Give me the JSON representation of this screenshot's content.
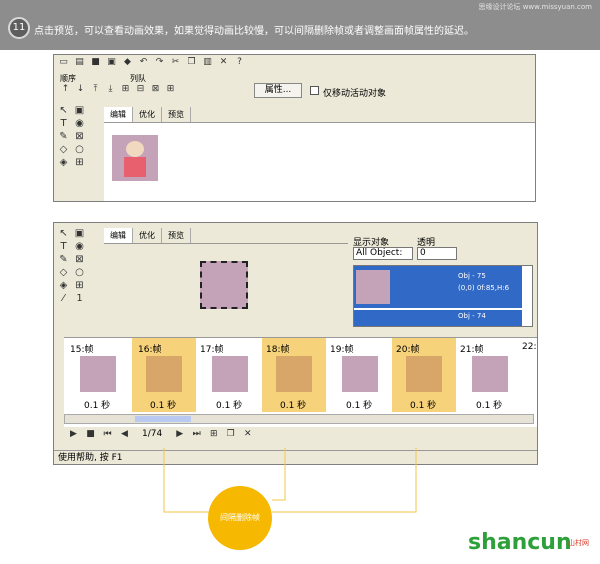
{
  "banner": {
    "step": "11",
    "text": "点击预览，可以查看动画效果，如果觉得动画比较慢，可以间隔删除帧或者调整画面帧属性的延迟。",
    "site": "思缘设计论坛 www.missyuan.com"
  },
  "win1": {
    "toolbar_labels": {
      "order": "顺序",
      "queue": "列队"
    },
    "properties_button": "属性...",
    "only_move_checkbox": "仅移动活动对象",
    "tabs": [
      "编辑",
      "优化",
      "预览"
    ]
  },
  "win2": {
    "tabs": [
      "编辑",
      "优化",
      "预览"
    ],
    "objects_label": "显示对象",
    "opacity_label": "透明",
    "objects_select": "All Object:",
    "opacity_value": "0",
    "object_rows": [
      {
        "name": "Obj - 75",
        "info": "(0,0) 0f:85,H:6"
      },
      {
        "name": "Obj - 74",
        "info": ""
      }
    ],
    "frames": [
      {
        "label": "15:帧",
        "delay": "0.1 秒",
        "highlight": false
      },
      {
        "label": "16:帧",
        "delay": "0.1 秒",
        "highlight": true
      },
      {
        "label": "17:帧",
        "delay": "0.1 秒",
        "highlight": false
      },
      {
        "label": "18:帧",
        "delay": "0.1 秒",
        "highlight": true
      },
      {
        "label": "19:帧",
        "delay": "0.1 秒",
        "highlight": false
      },
      {
        "label": "20:帧",
        "delay": "0.1 秒",
        "highlight": true
      },
      {
        "label": "21:帧",
        "delay": "0.1 秒",
        "highlight": false
      },
      {
        "label": "22:",
        "delay": "",
        "highlight": false
      }
    ],
    "frame_counter": "1/74",
    "status": "使用帮助, 按 F1"
  },
  "callout": "间隔删除帧",
  "logo": {
    "main": "shancun",
    "sub": "山村网"
  },
  "colors": {
    "highlight": "#f6d27a",
    "accent": "#f6b800",
    "selection": "#3169c6"
  }
}
